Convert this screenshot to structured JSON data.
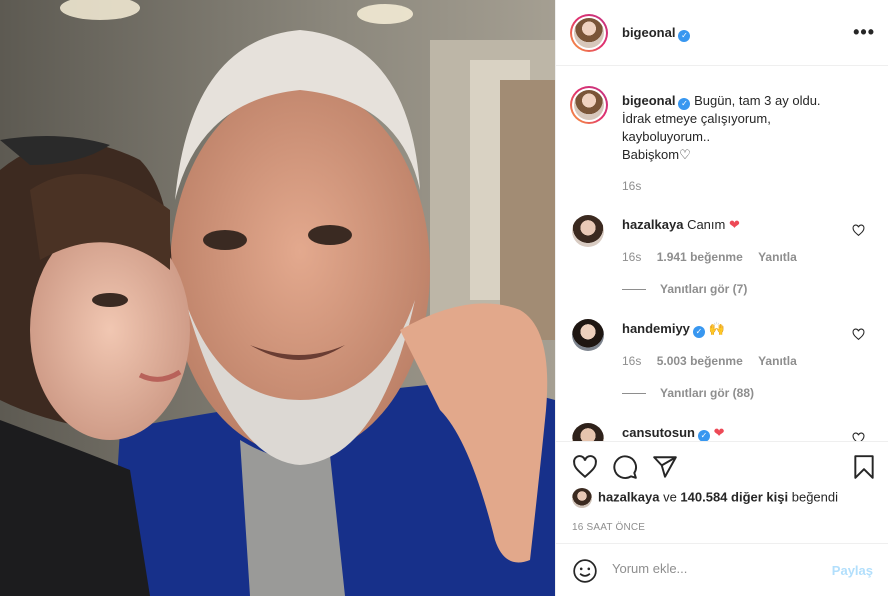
{
  "post": {
    "author": "bigeonal",
    "caption_lines": [
      "Bugün, tam 3 ay oldu.",
      "İdrak etmeye çalışıyorum,",
      "kayboluyorum..",
      "Babişkom♡"
    ],
    "caption_time": "16s"
  },
  "comments": [
    {
      "user": "hazalkaya",
      "text": "Canım",
      "emoji": "❤",
      "time": "16s",
      "likes": "1.941 beğenme",
      "reply": "Yanıtla",
      "view_replies": "Yanıtları gör (7)"
    },
    {
      "user": "handemiyy",
      "text": "",
      "emoji": "🙌",
      "time": "16s",
      "likes": "5.003 beğenme",
      "reply": "Yanıtla",
      "view_replies": "Yanıtları gör (88)"
    },
    {
      "user": "cansutosun",
      "text": "",
      "emoji": "❤"
    }
  ],
  "likes_line": {
    "user": "hazalkaya",
    "middle": "ve",
    "count": "140.584 diğer kişi",
    "end": "beğendi"
  },
  "timestamp": "16 SAAT ÖNCE",
  "add_comment": {
    "placeholder": "Yorum ekle...",
    "post_label": "Paylaş"
  },
  "icons": {
    "more": "more-icon",
    "like": "heart-icon",
    "comment": "comment-icon",
    "share": "share-icon",
    "save": "bookmark-icon",
    "emoji": "emoji-icon"
  },
  "colors": {
    "verified": "#3897f0",
    "heart_red": "#ed4956",
    "muted": "#8e8e8e",
    "post_disabled": "#b2dffc"
  }
}
